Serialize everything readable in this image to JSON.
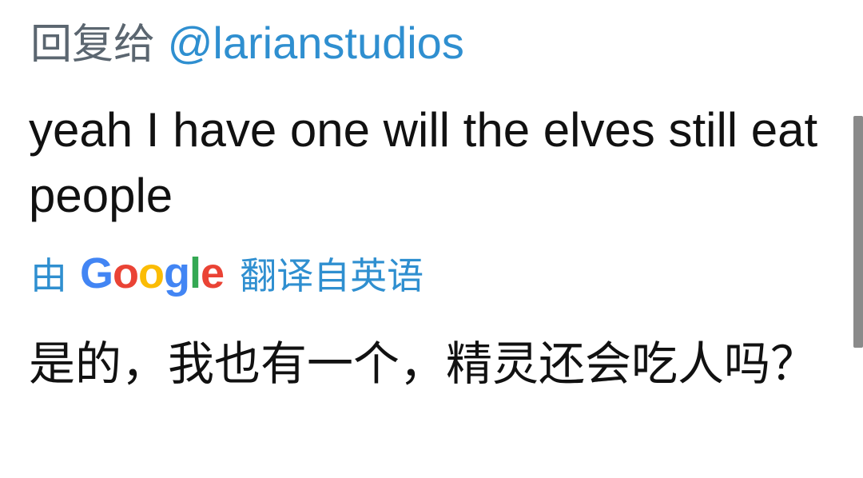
{
  "reply": {
    "prefix": "回复给",
    "handle": "@larianstudios"
  },
  "tweet": {
    "text": "yeah I have one will the elves still eat people"
  },
  "translation": {
    "by_label": "由",
    "google_letters": [
      "G",
      "o",
      "o",
      "g",
      "l",
      "e"
    ],
    "google_colors": [
      "#4285f4",
      "#ea4335",
      "#fbbc05",
      "#4285f4",
      "#34a853",
      "#ea4335"
    ],
    "from_label": "翻译自英语",
    "translated_text": "是的，我也有一个，精灵还会吃人吗？"
  },
  "colors": {
    "link": "#2f8fd0",
    "text": "#111111",
    "muted": "#5b6670",
    "scrollbar": "#8a8a8a"
  }
}
